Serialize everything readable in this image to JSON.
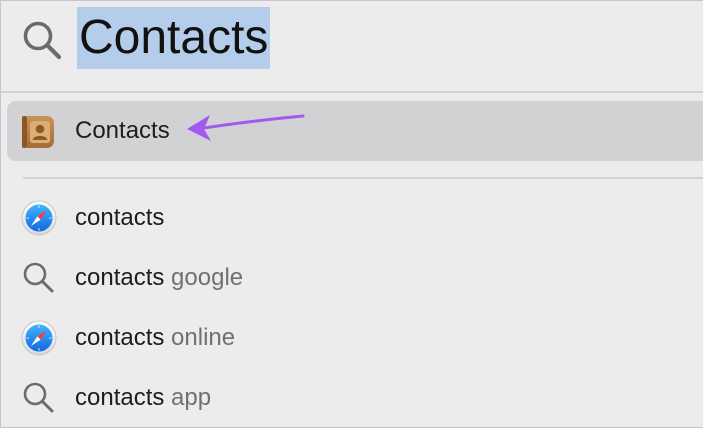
{
  "search": {
    "query": "Contacts"
  },
  "top_hit": {
    "label": "Contacts",
    "icon": "contacts-app-icon"
  },
  "annotation": {
    "arrow_color": "#a259f0"
  },
  "colors": {
    "selection_highlight": "#b4cdea",
    "top_hit_background": "#d2d2d4",
    "panel_background": "#ececec",
    "safari_blue": "#1a8cf0"
  },
  "suggestions": [
    {
      "query": "contacts",
      "suffix": "",
      "icon": "safari-icon"
    },
    {
      "query": "contacts",
      "suffix": " google",
      "icon": "search-icon"
    },
    {
      "query": "contacts",
      "suffix": " online",
      "icon": "safari-icon"
    },
    {
      "query": "contacts",
      "suffix": " app",
      "icon": "search-icon"
    }
  ]
}
